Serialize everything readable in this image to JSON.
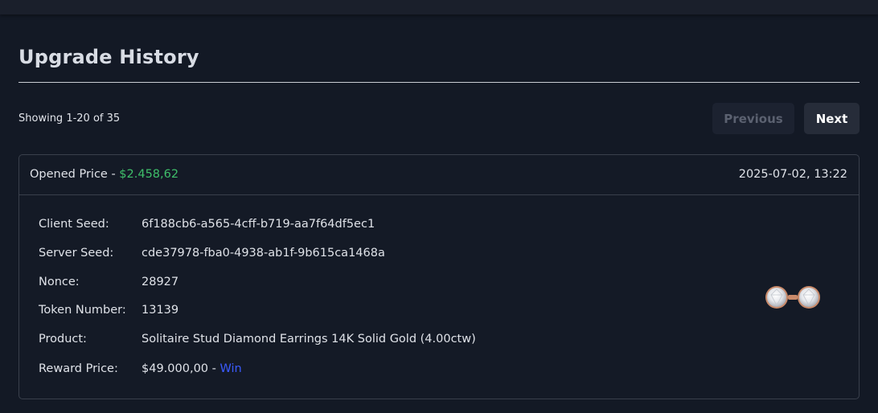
{
  "page": {
    "title": "Upgrade History",
    "showing": "Showing 1-20 of 35"
  },
  "pagination": {
    "previous_label": "Previous",
    "next_label": "Next"
  },
  "entry": {
    "opened_label": "Opened Price - ",
    "opened_price": "$2.458,62",
    "timestamp": "2025-07-02, 13:22",
    "client_seed_label": "Client Seed:",
    "client_seed": "6f188cb6-a565-4cff-b719-aa7f64df5ec1",
    "server_seed_label": "Server Seed:",
    "server_seed": "cde37978-fba0-4938-ab1f-9b615ca1468a",
    "nonce_label": "Nonce:",
    "nonce": "28927",
    "token_label": "Token Number:",
    "token": "13139",
    "product_label": "Product:",
    "product": "Solitaire Stud Diamond Earrings 14K Solid Gold (4.00ctw)",
    "reward_label": "Reward Price:",
    "reward_price": "$49.000,00",
    "reward_sep": " - ",
    "result": "Win"
  },
  "colors": {
    "background": "#131925",
    "opened_price": "#3fbf6a",
    "win": "#3b5bff"
  }
}
